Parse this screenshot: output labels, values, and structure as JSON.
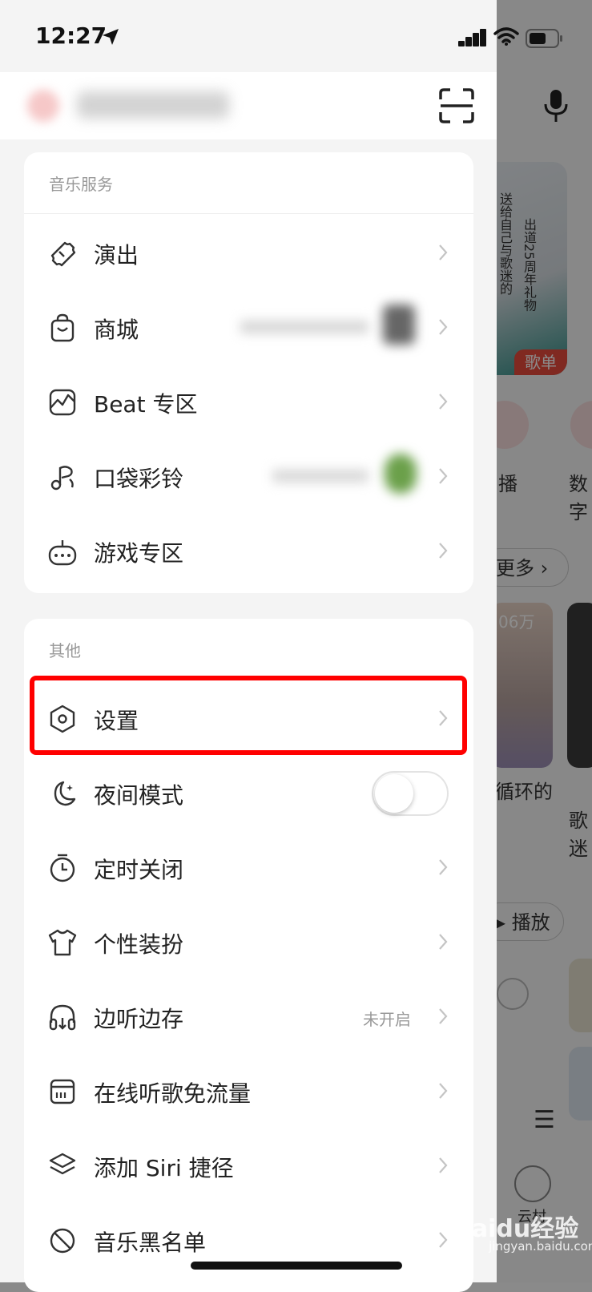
{
  "status_bar": {
    "time": "12:27"
  },
  "drawer": {
    "section1": {
      "title": "音乐服务",
      "items": [
        {
          "label": "演出",
          "icon": "ticket-icon"
        },
        {
          "label": "商城",
          "icon": "shopping-bag-icon"
        },
        {
          "label": "Beat 专区",
          "icon": "beat-wave-icon"
        },
        {
          "label": "口袋彩铃",
          "icon": "music-note-icon"
        },
        {
          "label": "游戏专区",
          "icon": "gamepad-icon"
        }
      ]
    },
    "section2": {
      "title": "其他",
      "items": [
        {
          "label": "设置",
          "icon": "settings-hexagon-icon"
        },
        {
          "label": "夜间模式",
          "icon": "moon-icon",
          "toggle": false
        },
        {
          "label": "定时关闭",
          "icon": "timer-icon"
        },
        {
          "label": "个性装扮",
          "icon": "tshirt-icon"
        },
        {
          "label": "边听边存",
          "icon": "headphones-icon",
          "status": "未开启"
        },
        {
          "label": "在线听歌免流量",
          "icon": "sim-card-icon"
        },
        {
          "label": "添加 Siri 捷径",
          "icon": "layers-icon"
        },
        {
          "label": "音乐黑名单",
          "icon": "block-icon"
        }
      ]
    }
  },
  "background": {
    "card_text_1": "送给自己与歌迷的",
    "card_text_2": "出道25周年礼物",
    "card_tag": "歌单",
    "live_label": "播",
    "digital_label": "数字",
    "more_label": "更多",
    "play_count": "06万",
    "song_title": "循环的",
    "song_title2": "歌迷",
    "play_button": "播放",
    "cloud_label": "云村"
  },
  "watermark": {
    "text": "Baidu经验",
    "sub": "jingyan.baidu.com"
  }
}
